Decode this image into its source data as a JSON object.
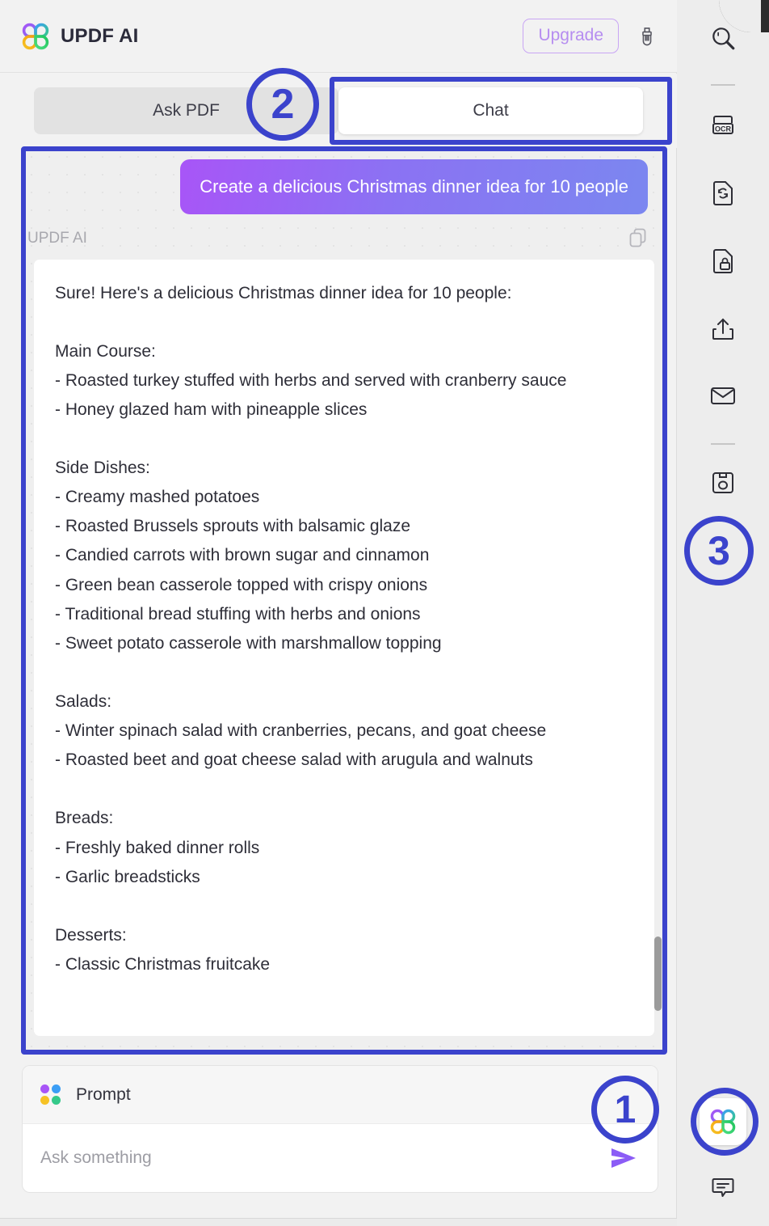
{
  "header": {
    "app_title": "UPDF AI",
    "upgrade_label": "Upgrade",
    "logo_icon": "updf-flower-logo-icon",
    "brush_icon": "brush-icon"
  },
  "tabs": [
    {
      "label": "Ask PDF",
      "active": false
    },
    {
      "label": "Chat",
      "active": true
    }
  ],
  "conversation": {
    "user_message": "Create a delicious Christmas dinner idea for 10 people",
    "assistant_name": "UPDF AI",
    "copy_icon": "copy-icon",
    "assistant_message": "Sure! Here's a delicious Christmas dinner idea for 10 people:\n\nMain Course:\n- Roasted turkey stuffed with herbs and served with cranberry sauce\n- Honey glazed ham with pineapple slices\n\nSide Dishes:\n- Creamy mashed potatoes\n- Roasted Brussels sprouts with balsamic glaze\n- Candied carrots with brown sugar and cinnamon\n- Green bean casserole topped with crispy onions\n- Traditional bread stuffing with herbs and onions\n- Sweet potato casserole with marshmallow topping\n\nSalads:\n- Winter spinach salad with cranberries, pecans, and goat cheese\n- Roasted beet and goat cheese salad with arugula and walnuts\n\nBreads:\n- Freshly baked dinner rolls\n- Garlic breadsticks\n\nDesserts:\n- Classic Christmas fruitcake"
  },
  "composer": {
    "prompt_label": "Prompt",
    "prompt_icon": "four-dots-icon",
    "input_value": "",
    "input_placeholder": "Ask something",
    "send_icon": "send-arrow-icon"
  },
  "tool_sidebar": {
    "items": [
      {
        "icon": "search-icon",
        "name": "search"
      },
      {
        "icon": "ocr-icon",
        "name": "ocr"
      },
      {
        "icon": "convert-document-icon",
        "name": "convert"
      },
      {
        "icon": "protect-document-icon",
        "name": "protect"
      },
      {
        "icon": "share-export-icon",
        "name": "share"
      },
      {
        "icon": "email-icon",
        "name": "email"
      },
      {
        "icon": "save-icon",
        "name": "save"
      }
    ],
    "ai_launch_icon": "updf-flower-logo-icon",
    "comment_icon": "comment-bubble-icon"
  },
  "annotations": [
    {
      "id": "1",
      "label": "1",
      "target": "prompt-composer"
    },
    {
      "id": "2",
      "label": "2",
      "target": "chat-tab"
    },
    {
      "id": "3",
      "label": "3",
      "target": "tool-sidebar"
    }
  ],
  "colors": {
    "annotation_blue": "#3b43cc",
    "user_bubble_from": "#a855f7",
    "user_bubble_to": "#7b87f0",
    "upgrade_purple": "#b68df0",
    "send_arrow": "#8b5cf6"
  }
}
